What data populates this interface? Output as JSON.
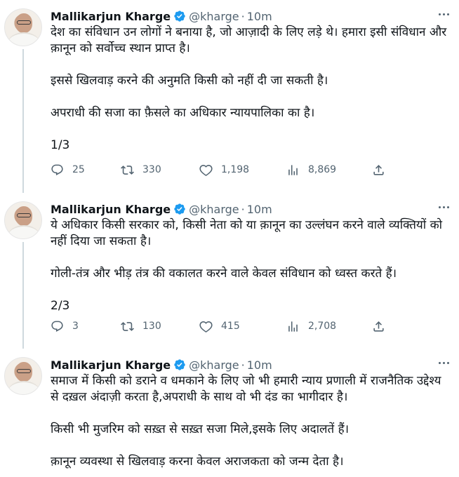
{
  "author": {
    "name": "Mallikarjun Kharge",
    "handle": "@kharge",
    "separator": "·",
    "time": "10m"
  },
  "tweets": [
    {
      "paragraphs": [
        "देश का संविधान उन लोगों ने बनाया है, जो आज़ादी के लिए लड़े थे। हमारा इसी संविधान और क़ानून को सर्वोच्च स्थान प्राप्त है।",
        "इससे खिलवाड़ करने की अनुमति किसी को नहीं दी जा सकती है।",
        "अपराधी की सजा का फ़ैसले का अधिकार न्यायपालिका का है।",
        "1/3"
      ],
      "replies": "25",
      "retweets": "330",
      "likes": "1,198",
      "views": "8,869"
    },
    {
      "paragraphs": [
        "ये अधिकार किसी सरकार को, किसी नेता को या क़ानून का उल्लंघन करने वाले व्यक्तियों को नहीं दिया जा सकता है।",
        "गोली-तंत्र और भीड़ तंत्र की वकालत करने वाले केवल संविधान को ध्वस्त करते हैं।",
        "2/3"
      ],
      "replies": "3",
      "retweets": "130",
      "likes": "415",
      "views": "2,708"
    },
    {
      "paragraphs": [
        "समाज में किसी को डराने व धमकाने के लिए जो भी हमारी न्याय प्रणाली में राजनैतिक उद्देश्य से दख़ल अंदाज़ी करता है,अपराधी के साथ वो भी दंड का भागीदार है।",
        "किसी भी मुजरिम को सख़्त से सख़्त सजा मिले,इसके लिए अदालतें हैं।",
        "क़ानून व्यवस्था से खिलवाड़ करना केवल अराजकता को जन्म देता है।"
      ]
    }
  ],
  "colors": {
    "text": "#0f1419",
    "secondary": "#536471",
    "verified": "#1d9bf0",
    "thread_line": "#cfd9de"
  },
  "icons": [
    "avatar",
    "verified-badge-icon",
    "more-icon",
    "reply-icon",
    "retweet-icon",
    "like-icon",
    "views-icon",
    "share-icon"
  ]
}
